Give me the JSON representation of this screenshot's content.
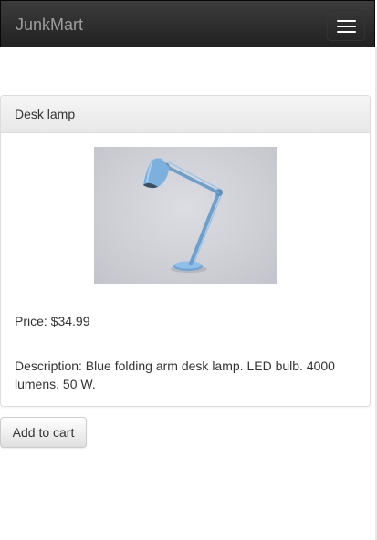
{
  "navbar": {
    "brand": "JunkMart",
    "toggle_icon": "hamburger-menu-icon"
  },
  "product": {
    "title": "Desk lamp",
    "price_label": "Price: $34.99",
    "description_label": "Description: Blue folding arm desk lamp. LED bulb. 4000 lumens. 50 W.",
    "image_subject": "blue folding arm desk lamp",
    "colors": {
      "lamp": "#7aaedb",
      "background": "#cfd0d6"
    }
  },
  "actions": {
    "add_to_cart": "Add to cart"
  }
}
